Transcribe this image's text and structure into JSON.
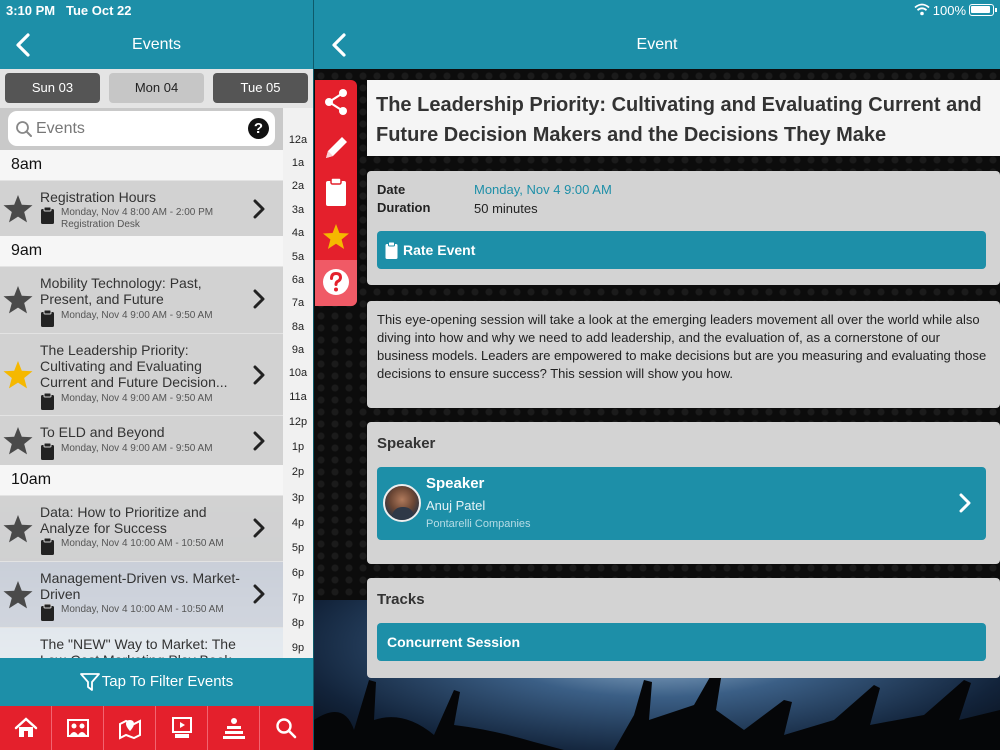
{
  "status": {
    "time": "3:10 PM",
    "date": "Tue Oct 22",
    "battery": "100%"
  },
  "left_header": {
    "title": "Events"
  },
  "day_tabs": [
    {
      "label": "Sun 03"
    },
    {
      "label": "Mon 04"
    },
    {
      "label": "Tue 05"
    }
  ],
  "search": {
    "placeholder": "Events",
    "help": "?"
  },
  "time_index": [
    "12a",
    "1a",
    "2a",
    "3a",
    "4a",
    "5a",
    "6a",
    "7a",
    "8a",
    "9a",
    "10a",
    "11a",
    "12p",
    "1p",
    "2p",
    "3p",
    "4p",
    "5p",
    "6p",
    "7p",
    "8p",
    "9p"
  ],
  "sections": {
    "s8": "8am",
    "s9": "9am",
    "s10": "10am"
  },
  "events": [
    {
      "title": "Registration Hours",
      "time": "Monday, Nov 4 8:00 AM - 2:00 PM",
      "location": "Registration Desk",
      "starred": false
    },
    {
      "title": "Mobility Technology: Past, Present, and Future",
      "time": "Monday, Nov 4 9:00 AM - 9:50 AM",
      "location": "",
      "starred": false
    },
    {
      "title": "The Leadership Priority: Cultivating and Evaluating Current and Future Decision...",
      "time": "Monday, Nov 4 9:00 AM - 9:50 AM",
      "location": "",
      "starred": true
    },
    {
      "title": "To ELD and Beyond",
      "time": "Monday, Nov 4 9:00 AM - 9:50 AM",
      "location": "",
      "starred": false
    },
    {
      "title": "Data: How to Prioritize and Analyze for Success",
      "time": "Monday, Nov 4 10:00 AM - 10:50 AM",
      "location": "",
      "starred": false
    },
    {
      "title": "Management-Driven vs. Market-Driven",
      "time": "Monday, Nov 4 10:00 AM - 10:50 AM",
      "location": "",
      "starred": false
    },
    {
      "title": "The \"NEW\" Way to Market: The Low-Cost Marketing Play Book",
      "time": "",
      "location": "",
      "starred": false
    }
  ],
  "filter": {
    "label": "Tap To Filter Events"
  },
  "bottom_nav": [
    "home-icon",
    "gallery-icon",
    "map-icon",
    "media-icon",
    "sponsor-icon",
    "search-icon"
  ],
  "right_header": {
    "title": "Event"
  },
  "side_tools": [
    "share-icon",
    "edit-icon",
    "clipboard-icon",
    "star-icon",
    "help-icon"
  ],
  "event": {
    "title": "The Leadership Priority: Cultivating and Evaluating Current and Future Decision Makers and the Decisions They Make",
    "date_label": "Date",
    "date_value": "Monday, Nov 4 9:00 AM",
    "duration_label": "Duration",
    "duration_value": "50 minutes",
    "rate_label": "Rate Event",
    "description": "This eye-opening session will take a look at the emerging leaders movement all over the world while also diving into how and why we need to add leadership, and the evaluation of, as a cornerstone of our business models. Leaders are empowered to make decisions but are you measuring and evaluating those decisions to ensure success? This session will show you how.",
    "speaker_heading": "Speaker",
    "speaker": {
      "role": "Speaker",
      "name": "Anuj Patel",
      "org": "Pontarelli Companies"
    },
    "tracks_heading": "Tracks",
    "track": "Concurrent Session"
  },
  "colors": {
    "teal": "#1d8fa8",
    "red": "#e4202c",
    "star_active": "#f5b800",
    "star_inactive": "#4a4a4a"
  }
}
